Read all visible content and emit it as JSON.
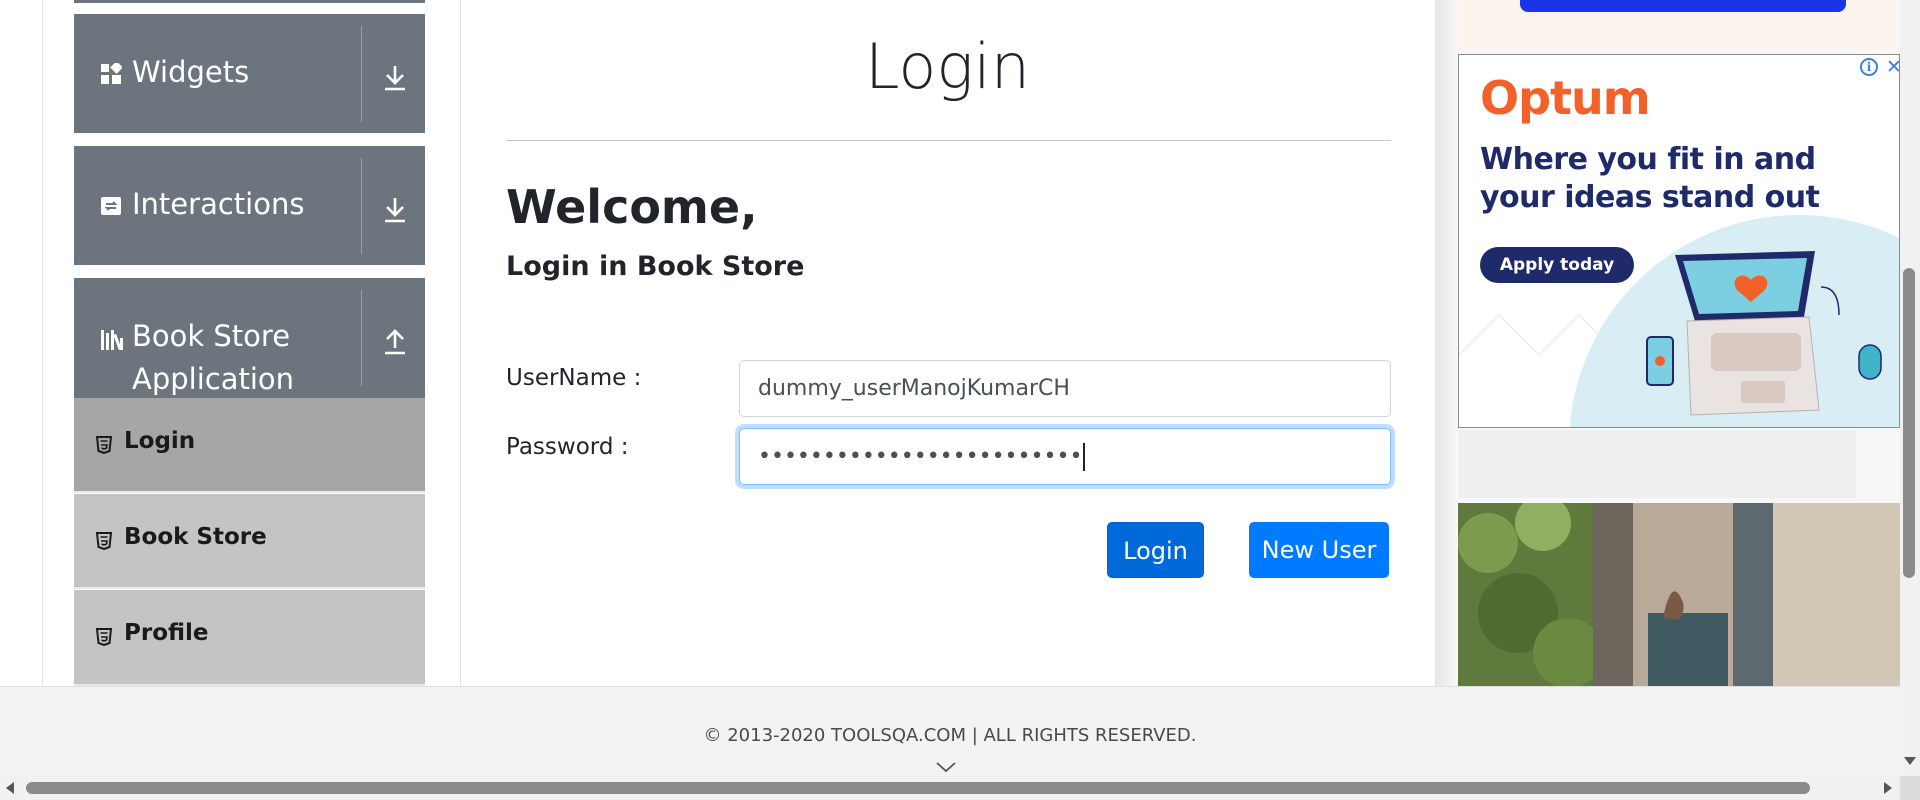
{
  "sidebar": {
    "groups": [
      {
        "label": "Widgets",
        "icon": "widgets-icon",
        "expanded": false
      },
      {
        "label": "Interactions",
        "icon": "interactions-icon",
        "expanded": false
      },
      {
        "label": "Book Store Application",
        "label_line1": "Book Store",
        "label_line2": "Application",
        "icon": "books-icon",
        "expanded": true
      }
    ],
    "items": [
      {
        "label": "Login",
        "icon": "html5-icon",
        "active": true
      },
      {
        "label": "Book Store",
        "icon": "html5-icon",
        "active": false
      },
      {
        "label": "Profile",
        "icon": "html5-icon",
        "active": false
      }
    ]
  },
  "main": {
    "title": "Login",
    "welcome": "Welcome,",
    "subtitle": "Login in Book Store",
    "username": {
      "label": "UserName :",
      "value": "dummy_userManojKumarCH"
    },
    "password": {
      "label": "Password :",
      "masked_value": "•••••••••••••••••••••••••"
    },
    "buttons": {
      "login": "Login",
      "new_user": "New User"
    }
  },
  "ad": {
    "brand": "Optum",
    "headline": "Where you fit in and your ideas stand out",
    "cta": "Apply today",
    "info_icon": "info-icon",
    "close_icon": "close-icon"
  },
  "footer": {
    "copyright": "© 2013-2020 TOOLSQA.COM | ALL RIGHTS RESERVED."
  },
  "colors": {
    "sidebar_group": "#6c757d",
    "sidebar_item": "#c4c4c4",
    "sidebar_item_active": "#a6a6a6",
    "primary": "#007bff",
    "primary_dark": "#0069d9",
    "ad_brand": "#f2612a",
    "ad_navy": "#1f2a6b"
  }
}
